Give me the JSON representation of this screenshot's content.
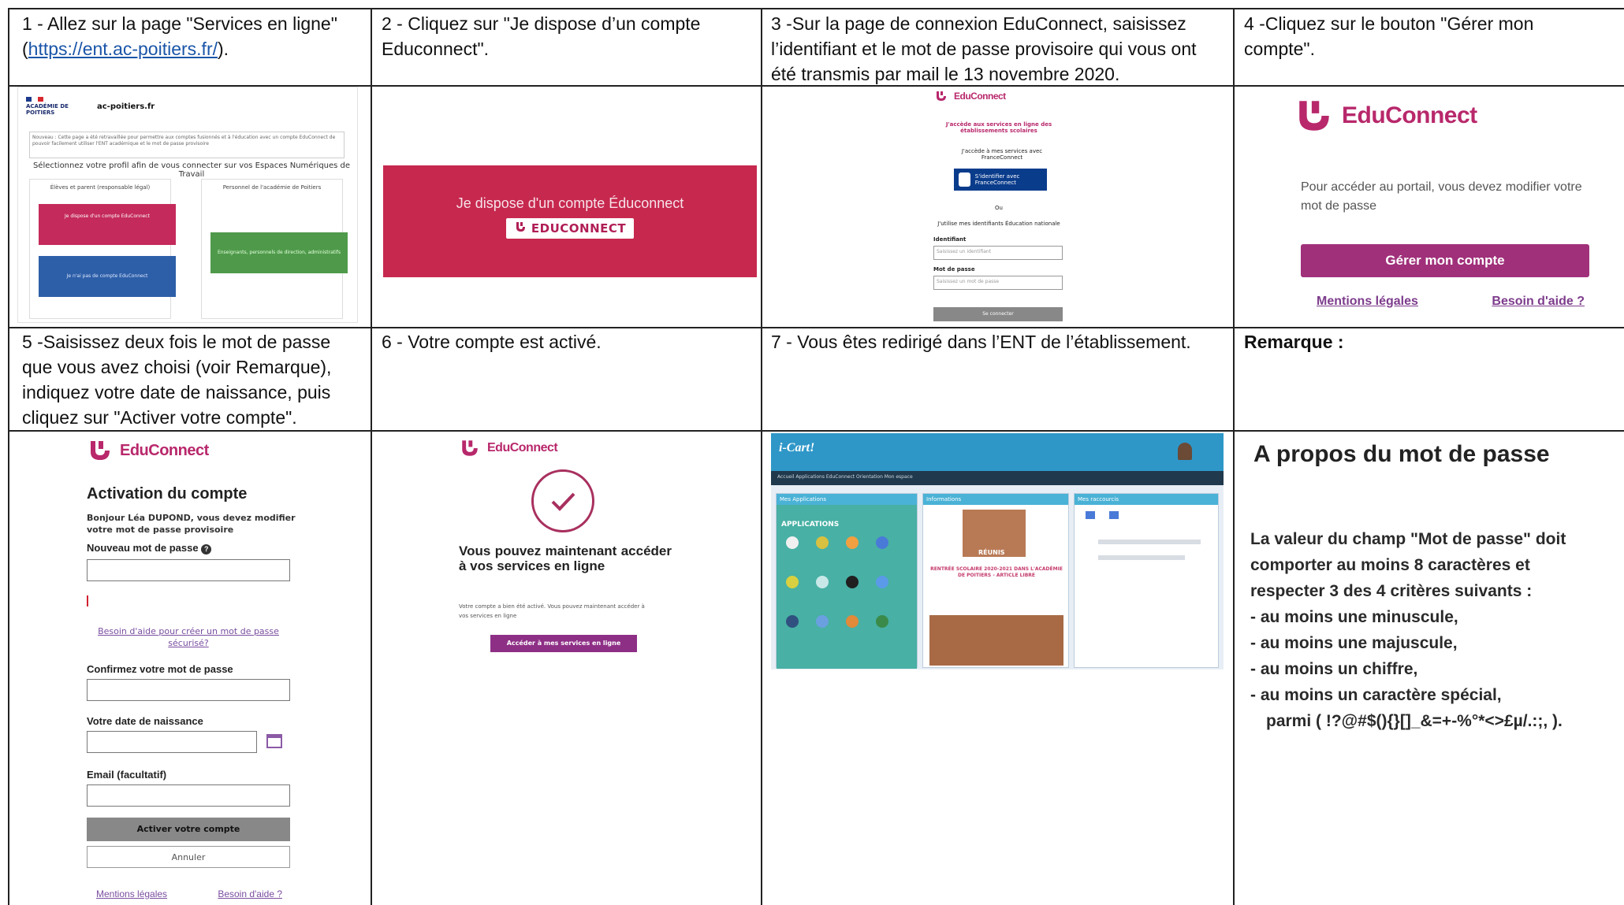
{
  "steps": {
    "s1": {
      "title": "1 - Allez sur la page \"Services en ligne\"",
      "paren_open": "(",
      "link": "https://ent.ac-poitiers.fr/",
      "paren_close": ")."
    },
    "s2": {
      "title": "2 - Cliquez sur \"Je dispose d’un compte Educonnect\"."
    },
    "s3": {
      "title": "3 -Sur la page de connexion EduConnect, saisissez l’identifiant et le mot de passe provisoire qui vous ont été transmis par mail le 13 novembre 2020."
    },
    "s4": {
      "title": "4 -Cliquez sur le bouton \"Gérer mon compte\"."
    },
    "s5": {
      "title": "5 -Saisissez deux fois le mot de passe que vous avez choisi (voir Remarque), indiquez votre date de naissance, puis cliquez sur \"Activer votre compte\"."
    },
    "s6": {
      "title": "6 - Votre compte est activé."
    },
    "s7": {
      "title": "7 - Vous êtes redirigé dans l’ENT de l’établissement."
    },
    "s8": {
      "title": "Remarque :"
    }
  },
  "cell1": {
    "academy": "ACADÉMIE DE POITIERS",
    "site": "ac-poitiers.fr",
    "notice": "Nouveau : Cette page a été retravaillée pour permettre aux comptes fusionnés et à l'éducation avec un compte EduConnect de pouvoir facilement utiliser l'ENT académique et le mot de passe provisoire",
    "select_profile": "Sélectionnez votre profil afin de vous connecter sur vos Espaces Numériques de Travail",
    "parents_header": "Élèves et parent (responsable légal)",
    "staff_header": "Personnel de l'académie de Poitiers",
    "btn_have_account": "Je dispose d'un compte EduConnect",
    "btn_no_account": "Je n'ai pas de compte EduConnect",
    "btn_staff": "Enseignants, personnels de direction, administratifs"
  },
  "cell2": {
    "button_text": "Je dispose d'un compte Éduconnect",
    "badge_text": "EDUCONNECT"
  },
  "cell3": {
    "logo": "EduConnect",
    "intro": "J'accède aux services en ligne des établissements scolaires",
    "fc_intro": "J'accède à mes services avec FranceConnect",
    "fc_btn": "S'identifier avec FranceConnect",
    "or": "Ou",
    "national": "J'utilise mes identifiants Éducation nationale",
    "id_label": "Identifiant",
    "id_placeholder": "Saisissez un identifiant",
    "pwd_label": "Mot de passe",
    "pwd_placeholder": "Saisissez un mot de passe",
    "submit": "Se connecter"
  },
  "cell4": {
    "logo": "EduConnect",
    "text": "Pour accéder au portail, vous devez modifier votre mot de passe",
    "button": "Gérer mon compte",
    "link_legal": "Mentions légales",
    "link_help": "Besoin d'aide ?"
  },
  "cell5": {
    "logo": "EduConnect",
    "heading": "Activation du compte",
    "hello": "Bonjour  Léa DUPOND,  vous devez modifier votre mot de passe provisoire",
    "new_pwd_label": "Nouveau mot de passe",
    "help_link": "Besoin d'aide pour créer un mot de passe sécurisé?",
    "confirm_label": "Confirmez votre mot de passe",
    "dob_label": "Votre date de naissance",
    "email_label": "Email (facultatif)",
    "activate": "Activer votre compte",
    "cancel": "Annuler",
    "link_legal": "Mentions légales",
    "link_help": "Besoin d'aide ?"
  },
  "cell6": {
    "logo": "EduConnect",
    "message": "Vous pouvez maintenant accéder à vos services en ligne",
    "small": "Votre compte a bien été activé. Vous pouvez maintenant accéder à vos services en ligne",
    "button": "Accéder à mes services en ligne"
  },
  "cell7": {
    "brand": "i-Cart!",
    "nav": "Accueil   Applications   EduConnect   Orientation   Mon espace",
    "col1": "Mes Applications",
    "apps_label": "APPLICATIONS",
    "col2": "Informations",
    "headline": "RENTRÉE SCOLAIRE 2020-2021 DANS L'ACADÉMIE DE POITIERS - ARTICLE LIBRE",
    "caption": "RÉUNIS",
    "col3": "Mes raccourcis"
  },
  "remark": {
    "heading": "A propos du mot de passe",
    "lines": [
      "La valeur du champ \"Mot de passe\" doit",
      "comporter au moins 8 caractères et",
      "respecter 3 des 4 critères suivants :",
      "- au moins une minuscule,",
      "- au moins une majuscule,",
      "- au moins un chiffre,",
      "- au moins un caractère spécial,",
      "parmi ( !?@#$(){}[]_&=+-%°*<>£µ/.:;, )."
    ]
  },
  "colors": {
    "educonnect_pink": "#b8286b",
    "button_red": "#c7284e",
    "ent_blue": "#2e97c8"
  }
}
